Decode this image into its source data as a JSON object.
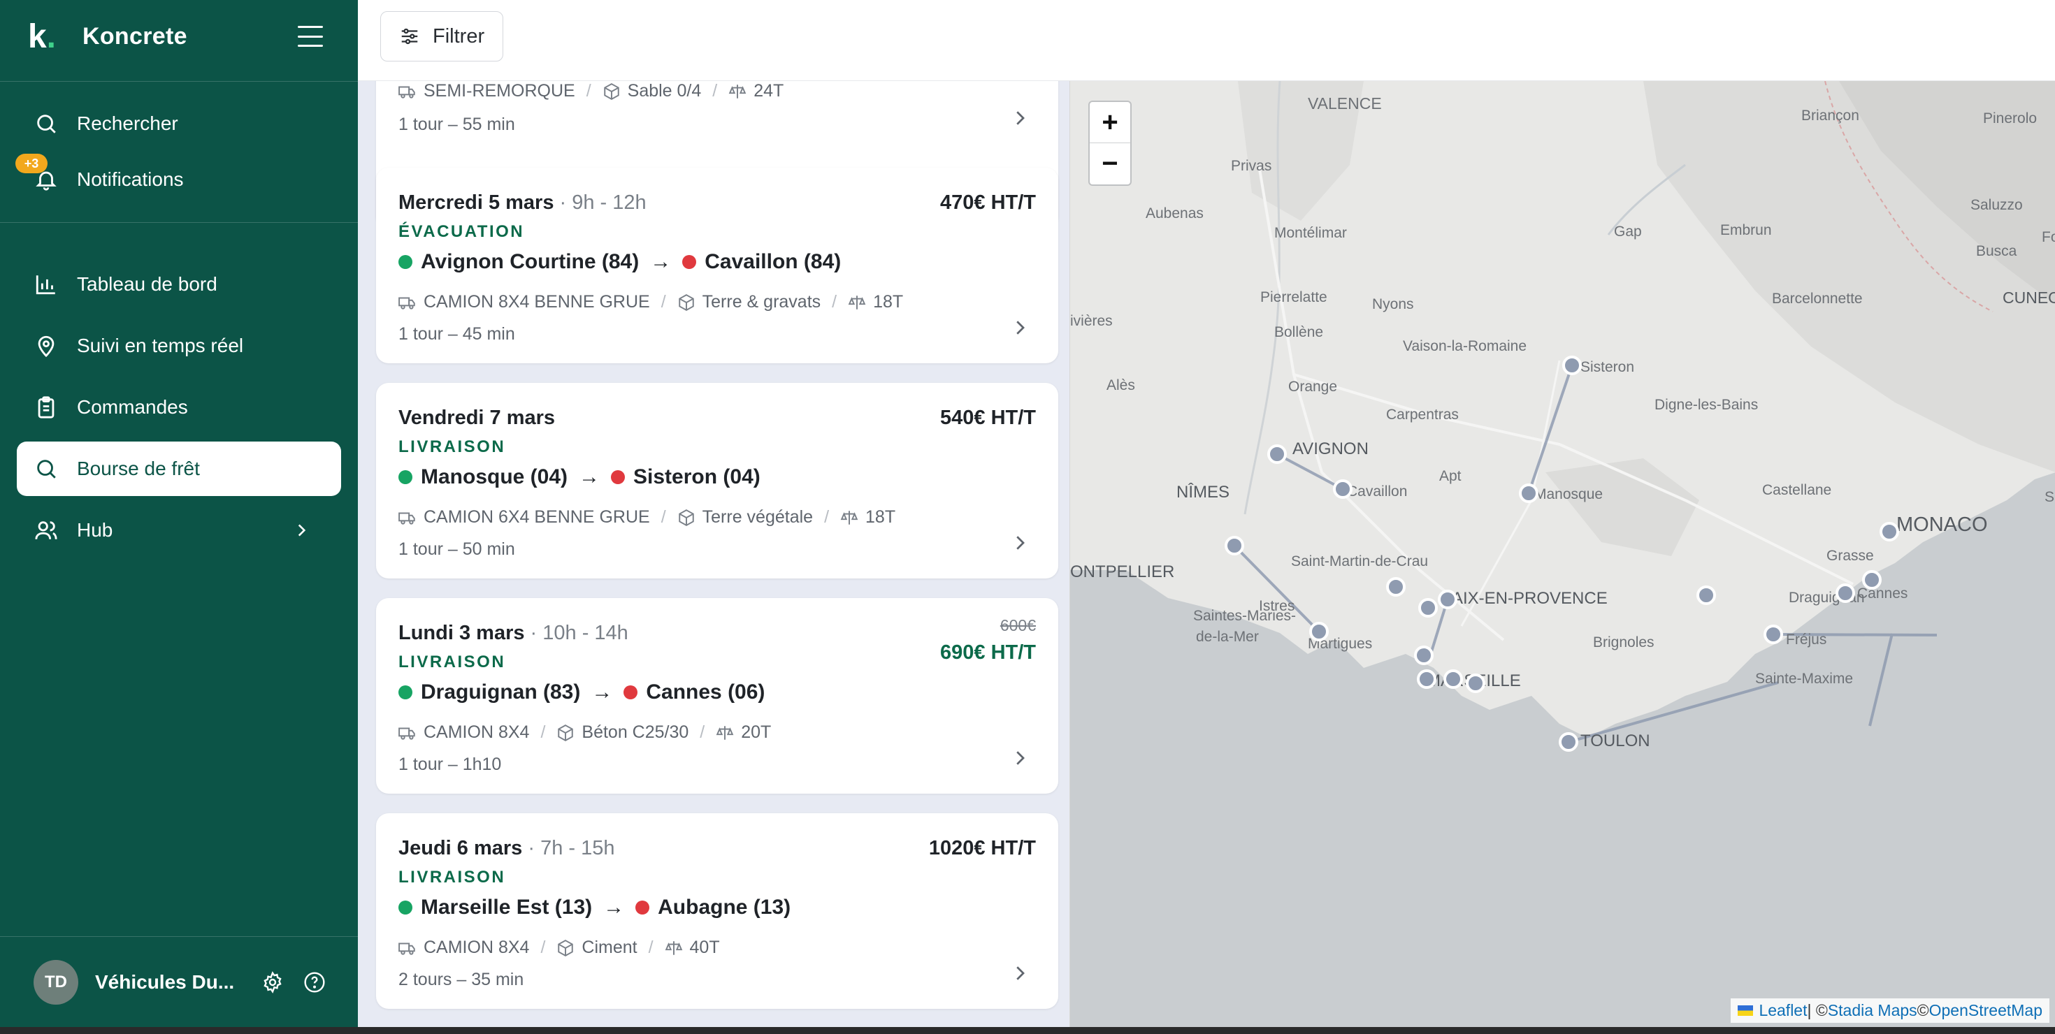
{
  "brand": {
    "name": "Koncrete",
    "logo_letter": "k",
    "logo_dot": "."
  },
  "sidebar": {
    "search_label": "Rechercher",
    "notifications_label": "Notifications",
    "notifications_badge": "+3",
    "items": [
      {
        "label": "Tableau de bord",
        "icon": "bar-chart-icon"
      },
      {
        "label": "Suivi en temps réel",
        "icon": "map-pin-icon"
      },
      {
        "label": "Commandes",
        "icon": "clipboard-icon"
      },
      {
        "label": "Bourse de frêt",
        "icon": "search-icon",
        "active": true
      },
      {
        "label": "Hub",
        "icon": "users-icon"
      }
    ],
    "user": {
      "initials": "TD",
      "name": "Véhicules Du..."
    }
  },
  "toolbar": {
    "filter_label": "Filtrer"
  },
  "offers": [
    {
      "truck": "SEMI-REMORQUE",
      "material": "Sable 0/4",
      "weight": "24T",
      "duration": "1 tour – 55 min"
    },
    {
      "date": "Mercredi 5 mars",
      "time": " · 9h - 12h",
      "price": "470€ HT/T",
      "type": "ÉVACUATION",
      "from": "Avignon Courtine (84)",
      "to": "Cavaillon (84)",
      "truck": "CAMION 8X4 BENNE GRUE",
      "material": "Terre & gravats",
      "weight": "18T",
      "duration": "1 tour – 45 min"
    },
    {
      "date": "Vendredi 7 mars",
      "time": "",
      "price": "540€ HT/T",
      "type": "LIVRAISON",
      "from": "Manosque (04)",
      "to": "Sisteron (04)",
      "truck": "CAMION 6X4 BENNE GRUE",
      "material": "Terre végétale",
      "weight": "18T",
      "duration": "1 tour – 50 min"
    },
    {
      "date": "Lundi 3 mars",
      "time": " · 10h - 14h",
      "price_old": "600€",
      "price": "690€ HT/T",
      "type": "LIVRAISON",
      "from": "Draguignan (83)",
      "to": "Cannes (06)",
      "truck": "CAMION 8X4",
      "material": "Béton C25/30",
      "weight": "20T",
      "duration": "1 tour – 1h10"
    },
    {
      "date": "Jeudi 6 mars",
      "time": " · 7h - 15h",
      "price": "1020€ HT/T",
      "type": "LIVRAISON",
      "from": "Marseille Est (13)",
      "to": "Aubagne (13)",
      "truck": "CAMION 8X4",
      "material": "Ciment",
      "weight": "40T",
      "duration": "2 tours – 35 min"
    }
  ],
  "map": {
    "zoom_in": "+",
    "zoom_out": "−",
    "labels": [
      "VALENCE",
      "Privas",
      "Aubenas",
      "Montélimar",
      "Pierrelatte",
      "Bollène",
      "Nyons",
      "Vaison-la-Romaine",
      "Orange",
      "Carpentras",
      "AVIGNON",
      "Cavaillon",
      "Apt",
      "NÎMES",
      "Alès",
      "Gap",
      "Embrun",
      "Briançon",
      "Pinerolo",
      "Saluzzo",
      "Busca",
      "CUNEO",
      "Fos",
      "Barcelonnette",
      "Sisteron",
      "Digne-les-Bains",
      "Manosque",
      "Castellane",
      "MONACO",
      "Grasse",
      "Cannes",
      "Draguignan",
      "Fréjus",
      "Sainte-Maxime",
      "TOULON",
      "Brignoles",
      "AIX-EN-PROVENCE",
      "MARSEILLE",
      "Martigues",
      "Istres",
      "Saint-Martin-de-Crau",
      "Saintes-Maries-",
      "de-la-Mer",
      "ONTPELLIER",
      "ivières",
      "Sa"
    ],
    "attribution": {
      "leaflet": "Leaflet",
      "sep": " | © ",
      "stadia": "Stadia Maps",
      "sep2": " © ",
      "osm": "OpenStreetMap"
    }
  }
}
